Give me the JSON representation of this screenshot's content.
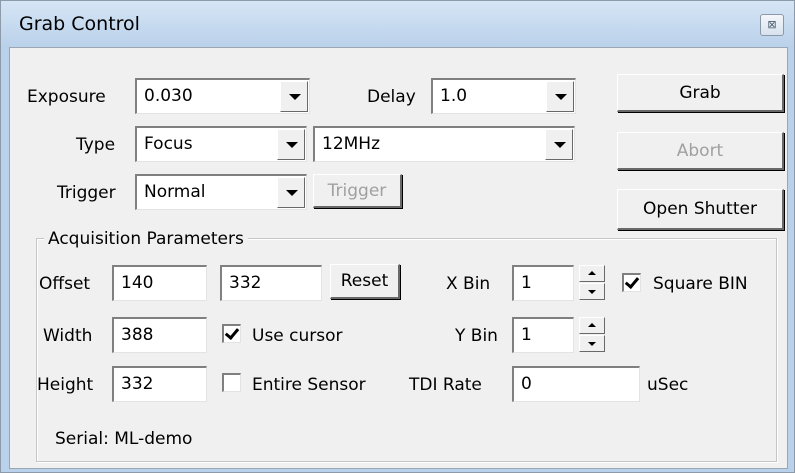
{
  "window": {
    "title": "Grab Control",
    "close_symbol": "⊠"
  },
  "top": {
    "exposure_label": "Exposure",
    "exposure_value": "0.030",
    "delay_label": "Delay",
    "delay_value": "1.0",
    "type_label": "Type",
    "type_value": "Focus",
    "speed_value": "12MHz",
    "trigger_label": "Trigger",
    "trigger_value": "Normal",
    "trigger_button": "Trigger"
  },
  "buttons": {
    "grab": "Grab",
    "abort": "Abort",
    "open_shutter": "Open Shutter"
  },
  "acquisition": {
    "group_title": "Acquisition Parameters",
    "offset_label": "Offset",
    "offset_x": "140",
    "offset_y": "332",
    "reset": "Reset",
    "width_label": "Width",
    "width_value": "388",
    "use_cursor": "Use cursor",
    "use_cursor_checked": true,
    "height_label": "Height",
    "height_value": "332",
    "entire_sensor": "Entire Sensor",
    "entire_sensor_checked": false,
    "xbin_label": "X Bin",
    "xbin_value": "1",
    "square_bin": "Square BIN",
    "square_bin_checked": true,
    "ybin_label": "Y Bin",
    "ybin_value": "1",
    "tdi_label": "TDI Rate",
    "tdi_value": "0",
    "tdi_unit": "uSec",
    "serial": "Serial: ML-demo"
  }
}
